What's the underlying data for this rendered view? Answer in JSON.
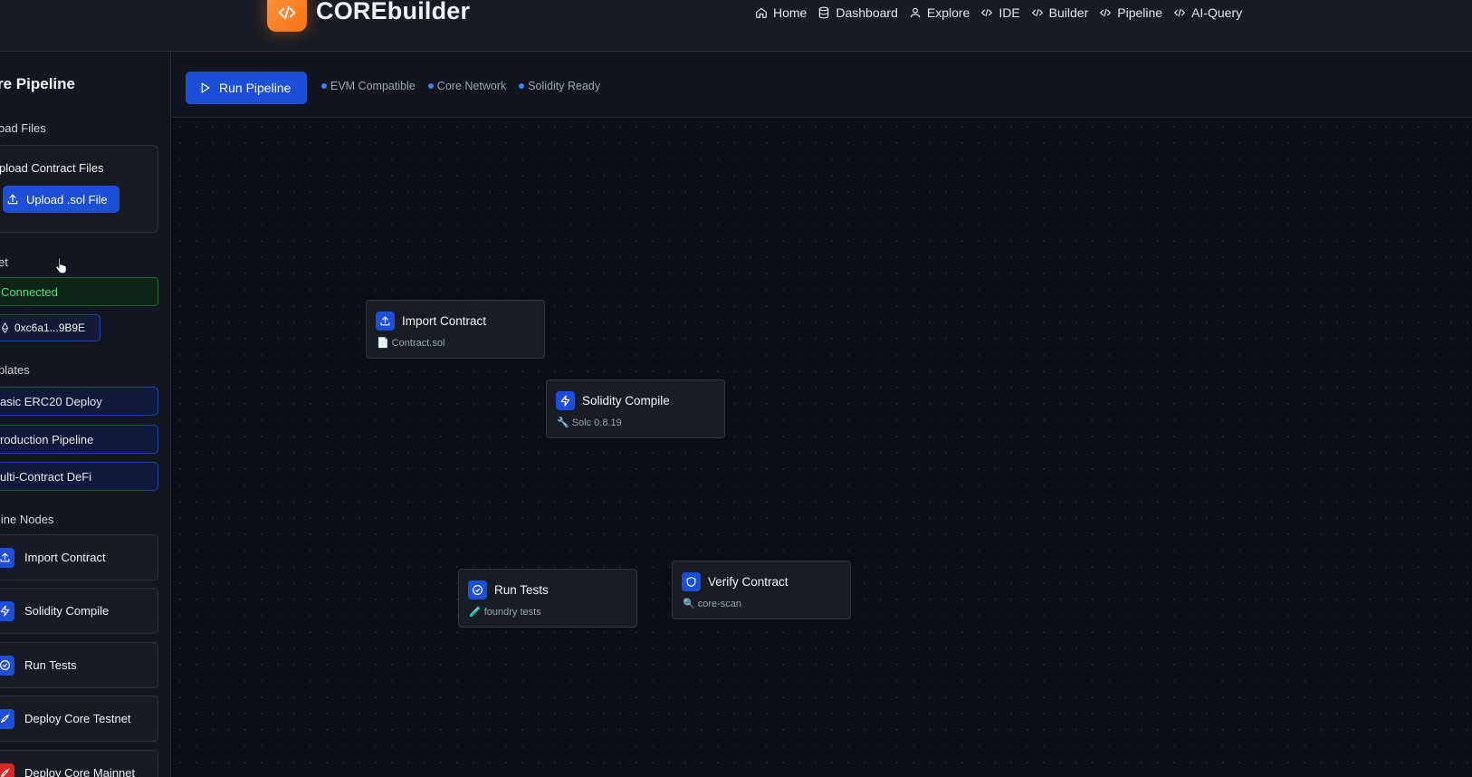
{
  "app": {
    "name": "COREbuilder",
    "logo_glyph": "</>",
    "colors": {
      "accent": "#1d4ed8",
      "brand": "#f97316",
      "success": "#4ade80",
      "danger": "#dc2626"
    }
  },
  "nav": [
    {
      "label": "Home",
      "icon": "home-icon"
    },
    {
      "label": "Dashboard",
      "icon": "dashboard-icon"
    },
    {
      "label": "Explore",
      "icon": "user-icon"
    },
    {
      "label": "IDE",
      "icon": "code-icon"
    },
    {
      "label": "Builder",
      "icon": "code-icon"
    },
    {
      "label": "Pipeline",
      "icon": "code-icon"
    },
    {
      "label": "AI-Query",
      "icon": "code-icon"
    }
  ],
  "sidebar": {
    "title": "re Pipeline",
    "upload_section": "oad Files",
    "upload_card_title": "pload Contract Files",
    "upload_button": "Upload .sol File",
    "wallet_section": "et",
    "wallet_status": "Connected",
    "wallet_address": "0xc6a1...9B9E",
    "templates_section": "plates",
    "templates": [
      "asic ERC20 Deploy",
      "roduction Pipeline",
      "ulti-Contract DeFi"
    ],
    "nodes_section": "line Nodes",
    "nodes": [
      {
        "label": "Import Contract",
        "icon": "upload-icon",
        "color": "blue"
      },
      {
        "label": "Solidity Compile",
        "icon": "bolt-icon",
        "color": "blue"
      },
      {
        "label": "Run Tests",
        "icon": "check-circle-icon",
        "color": "blue"
      },
      {
        "label": "Deploy Core Testnet",
        "icon": "rocket-icon",
        "color": "blue"
      },
      {
        "label": "Deploy Core Mainnet",
        "icon": "rocket-icon",
        "color": "red"
      }
    ]
  },
  "toolbar": {
    "run_label": "Run Pipeline",
    "badges": [
      "EVM Compatible",
      "Core Network",
      "Solidity Ready"
    ]
  },
  "canvas": {
    "nodes": [
      {
        "title": "Import Contract",
        "sub_icon": "📄",
        "sub": "Contract.sol",
        "icon": "upload-icon"
      },
      {
        "title": "Solidity Compile",
        "sub_icon": "🔧",
        "sub": "Solc 0.8.19",
        "icon": "bolt-icon"
      },
      {
        "title": "Run Tests",
        "sub_icon": "🧪",
        "sub": "foundry tests",
        "icon": "check-circle-icon"
      },
      {
        "title": "Verify Contract",
        "sub_icon": "🔍",
        "sub": "core-scan",
        "icon": "shield-icon"
      }
    ]
  }
}
